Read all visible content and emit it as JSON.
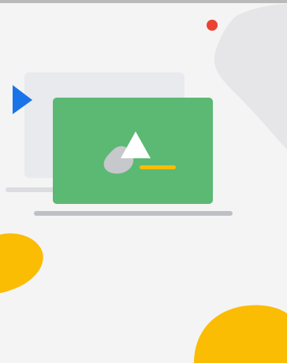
{
  "illustration": {
    "colors": {
      "background": "#f4f4f4",
      "top_rule": "#b9b9b9",
      "back_panel": "#e8eaed",
      "back_stand": "#dadce0",
      "front_panel": "#5bb974",
      "front_stand": "#bdc1c6",
      "play_accent": "#1a73e8",
      "dot_accent": "#ea4335",
      "blob_yellow": "#fbbc04",
      "rock_gray": "#c6c8cb",
      "triangle_white": "#ffffff",
      "dash_yellow": "#fbbc04"
    },
    "icons": [
      "play-triangle-icon",
      "red-dot-icon",
      "mountain-image-icon"
    ]
  }
}
